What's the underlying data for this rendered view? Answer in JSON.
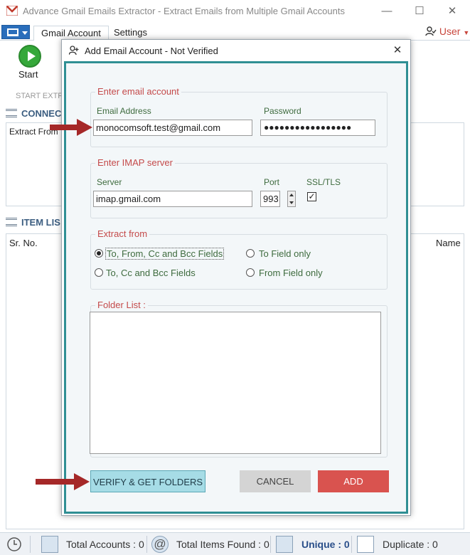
{
  "window": {
    "title": "Advance Gmail Emails Extractor - Extract Emails from Multiple Gmail Accounts",
    "minimize": "—",
    "maximize": "☐",
    "close": "✕"
  },
  "ribbon": {
    "tabs": [
      {
        "label": "Gmail Account"
      },
      {
        "label": "Settings"
      }
    ],
    "user_label": "User",
    "start_label": "Start",
    "group_label": "START EXTR"
  },
  "panels": {
    "connections": {
      "title": "CONNEC",
      "column": "Extract From"
    },
    "items": {
      "title": "ITEM LIS",
      "col_sr": "Sr. No.",
      "col_name": "Name"
    }
  },
  "status_bar": {
    "total_accounts": "Total Accounts : 0",
    "total_items": "Total Items Found : 0",
    "unique": "Unique : 0",
    "duplicate": "Duplicate : 0"
  },
  "dialog": {
    "title": "Add Email Account - Not Verified",
    "close": "✕",
    "account": {
      "group_title": "Enter email account",
      "email_label": "Email Address",
      "email_value": "monocomsoft.test@gmail.com",
      "password_label": "Password",
      "password_value": "●●●●●●●●●●●●●●●●●"
    },
    "imap": {
      "group_title": "Enter IMAP server",
      "server_label": "Server",
      "server_value": "imap.gmail.com",
      "port_label": "Port",
      "port_value": "993",
      "ssl_label": "SSL/TLS",
      "ssl_checked": "✓"
    },
    "extract": {
      "group_title": "Extract from",
      "options": [
        {
          "label": "To, From, Cc and Bcc Fields",
          "selected": true
        },
        {
          "label": "To Field only",
          "selected": false
        },
        {
          "label": "To, Cc and Bcc Fields",
          "selected": false
        },
        {
          "label": "From Field only",
          "selected": false
        }
      ]
    },
    "folders": {
      "group_title": "Folder List :"
    },
    "buttons": {
      "verify": "VERIFY & GET FOLDERS",
      "cancel": "CANCEL",
      "add": "ADD"
    }
  },
  "colors": {
    "accent_teal": "#2f8f94",
    "add_red": "#d9534f",
    "group_title_red": "#c44a4a",
    "arrow_red": "#a52828"
  }
}
